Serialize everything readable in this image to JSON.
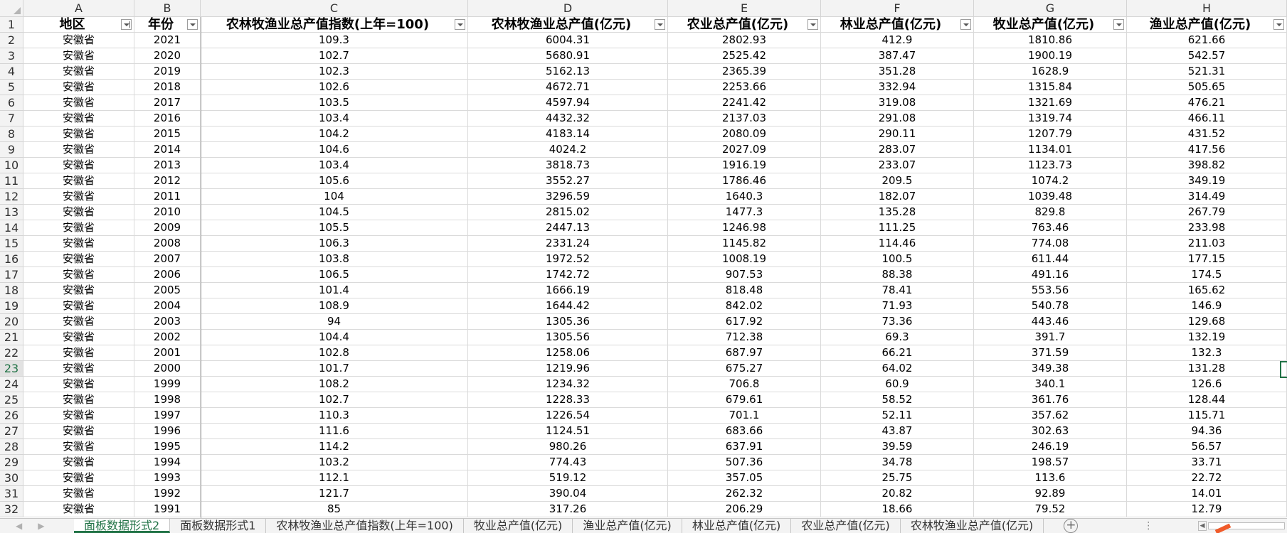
{
  "columns": [
    "A",
    "B",
    "C",
    "D",
    "E",
    "F",
    "G",
    "H"
  ],
  "headers": [
    {
      "label": "地区",
      "filter": "sorted"
    },
    {
      "label": "年份",
      "filter": "normal"
    },
    {
      "label": "农林牧渔业总产值指数(上年=100)",
      "filter": "normal"
    },
    {
      "label": "农林牧渔业总产值(亿元)",
      "filter": "normal"
    },
    {
      "label": "农业总产值(亿元)",
      "filter": "normal"
    },
    {
      "label": "林业总产值(亿元)",
      "filter": "normal"
    },
    {
      "label": "牧业总产值(亿元)",
      "filter": "normal"
    },
    {
      "label": "渔业总产值(亿元)",
      "filter": "normal"
    }
  ],
  "rows": [
    [
      "安徽省",
      "2021",
      "109.3",
      "6004.31",
      "2802.93",
      "412.9",
      "1810.86",
      "621.66"
    ],
    [
      "安徽省",
      "2020",
      "102.7",
      "5680.91",
      "2525.42",
      "387.47",
      "1900.19",
      "542.57"
    ],
    [
      "安徽省",
      "2019",
      "102.3",
      "5162.13",
      "2365.39",
      "351.28",
      "1628.9",
      "521.31"
    ],
    [
      "安徽省",
      "2018",
      "102.6",
      "4672.71",
      "2253.66",
      "332.94",
      "1315.84",
      "505.65"
    ],
    [
      "安徽省",
      "2017",
      "103.5",
      "4597.94",
      "2241.42",
      "319.08",
      "1321.69",
      "476.21"
    ],
    [
      "安徽省",
      "2016",
      "103.4",
      "4432.32",
      "2137.03",
      "291.08",
      "1319.74",
      "466.11"
    ],
    [
      "安徽省",
      "2015",
      "104.2",
      "4183.14",
      "2080.09",
      "290.11",
      "1207.79",
      "431.52"
    ],
    [
      "安徽省",
      "2014",
      "104.6",
      "4024.2",
      "2027.09",
      "283.07",
      "1134.01",
      "417.56"
    ],
    [
      "安徽省",
      "2013",
      "103.4",
      "3818.73",
      "1916.19",
      "233.07",
      "1123.73",
      "398.82"
    ],
    [
      "安徽省",
      "2012",
      "105.6",
      "3552.27",
      "1786.46",
      "209.5",
      "1074.2",
      "349.19"
    ],
    [
      "安徽省",
      "2011",
      "104",
      "3296.59",
      "1640.3",
      "182.07",
      "1039.48",
      "314.49"
    ],
    [
      "安徽省",
      "2010",
      "104.5",
      "2815.02",
      "1477.3",
      "135.28",
      "829.8",
      "267.79"
    ],
    [
      "安徽省",
      "2009",
      "105.5",
      "2447.13",
      "1246.98",
      "111.25",
      "763.46",
      "233.98"
    ],
    [
      "安徽省",
      "2008",
      "106.3",
      "2331.24",
      "1145.82",
      "114.46",
      "774.08",
      "211.03"
    ],
    [
      "安徽省",
      "2007",
      "103.8",
      "1972.52",
      "1008.19",
      "100.5",
      "611.44",
      "177.15"
    ],
    [
      "安徽省",
      "2006",
      "106.5",
      "1742.72",
      "907.53",
      "88.38",
      "491.16",
      "174.5"
    ],
    [
      "安徽省",
      "2005",
      "101.4",
      "1666.19",
      "818.48",
      "78.41",
      "553.56",
      "165.62"
    ],
    [
      "安徽省",
      "2004",
      "108.9",
      "1644.42",
      "842.02",
      "71.93",
      "540.78",
      "146.9"
    ],
    [
      "安徽省",
      "2003",
      "94",
      "1305.36",
      "617.92",
      "73.36",
      "443.46",
      "129.68"
    ],
    [
      "安徽省",
      "2002",
      "104.4",
      "1305.56",
      "712.38",
      "69.3",
      "391.7",
      "132.19"
    ],
    [
      "安徽省",
      "2001",
      "102.8",
      "1258.06",
      "687.97",
      "66.21",
      "371.59",
      "132.3"
    ],
    [
      "安徽省",
      "2000",
      "101.7",
      "1219.96",
      "675.27",
      "64.02",
      "349.38",
      "131.28"
    ],
    [
      "安徽省",
      "1999",
      "108.2",
      "1234.32",
      "706.8",
      "60.9",
      "340.1",
      "126.6"
    ],
    [
      "安徽省",
      "1998",
      "102.7",
      "1228.33",
      "679.61",
      "58.52",
      "361.76",
      "128.44"
    ],
    [
      "安徽省",
      "1997",
      "110.3",
      "1226.54",
      "701.1",
      "52.11",
      "357.62",
      "115.71"
    ],
    [
      "安徽省",
      "1996",
      "111.6",
      "1124.51",
      "683.66",
      "43.87",
      "302.63",
      "94.36"
    ],
    [
      "安徽省",
      "1995",
      "114.2",
      "980.26",
      "637.91",
      "39.59",
      "246.19",
      "56.57"
    ],
    [
      "安徽省",
      "1994",
      "103.2",
      "774.43",
      "507.36",
      "34.78",
      "198.57",
      "33.71"
    ],
    [
      "安徽省",
      "1993",
      "112.1",
      "519.12",
      "357.05",
      "25.75",
      "113.6",
      "22.72"
    ],
    [
      "安徽省",
      "1992",
      "121.7",
      "390.04",
      "262.32",
      "20.82",
      "92.89",
      "14.01"
    ],
    [
      "安徽省",
      "1991",
      "85",
      "317.26",
      "206.29",
      "18.66",
      "79.52",
      "12.79"
    ]
  ],
  "active_row": 23,
  "sheet_tabs": [
    "面板数据形式2",
    "面板数据形式1",
    "农林牧渔业总产值指数(上年=100)",
    "牧业总产值(亿元)",
    "渔业总产值(亿元)",
    "林业总产值(亿元)",
    "农业总产值(亿元)",
    "农林牧渔业总产值(亿元)"
  ],
  "active_tab": 0,
  "icons": {
    "add_sheet": "plus-circle-icon",
    "more": "ellipsis-icon",
    "nav_prev": "chevron-left-icon",
    "nav_next": "chevron-right-icon"
  },
  "accent_color": "#217346"
}
